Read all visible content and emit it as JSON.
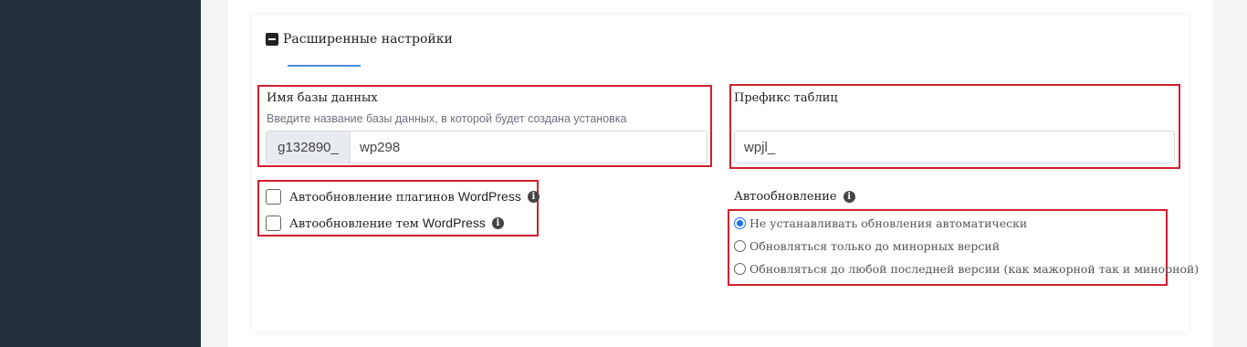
{
  "section": {
    "title": "Расширенные настройки"
  },
  "database": {
    "label": "Имя базы данных",
    "hint": "Введите название базы данных, в которой будет создана установка",
    "prefix": "g132890_",
    "value": "wp298"
  },
  "table_prefix": {
    "label": "Префикс таблиц",
    "value": "wpjl_"
  },
  "auto_update_checks": [
    {
      "label": "Автообновление плагинов",
      "brand": "WordPress",
      "checked": false
    },
    {
      "label": "Автообновление тем",
      "brand": "WordPress",
      "checked": false
    }
  ],
  "auto_update": {
    "label": "Автообновление",
    "options": [
      {
        "label": "Не устанавливать обновления автоматически",
        "selected": true
      },
      {
        "label": "Обновляться только до минорных версий",
        "selected": false
      },
      {
        "label": "Обновляться до любой последней версии (как мажорной так и минорной)",
        "selected": false
      }
    ]
  },
  "colors": {
    "sidebar": "#252f3e",
    "highlight": "#d0202e",
    "accent": "#4a90d9",
    "radio": "#1a73e8"
  }
}
